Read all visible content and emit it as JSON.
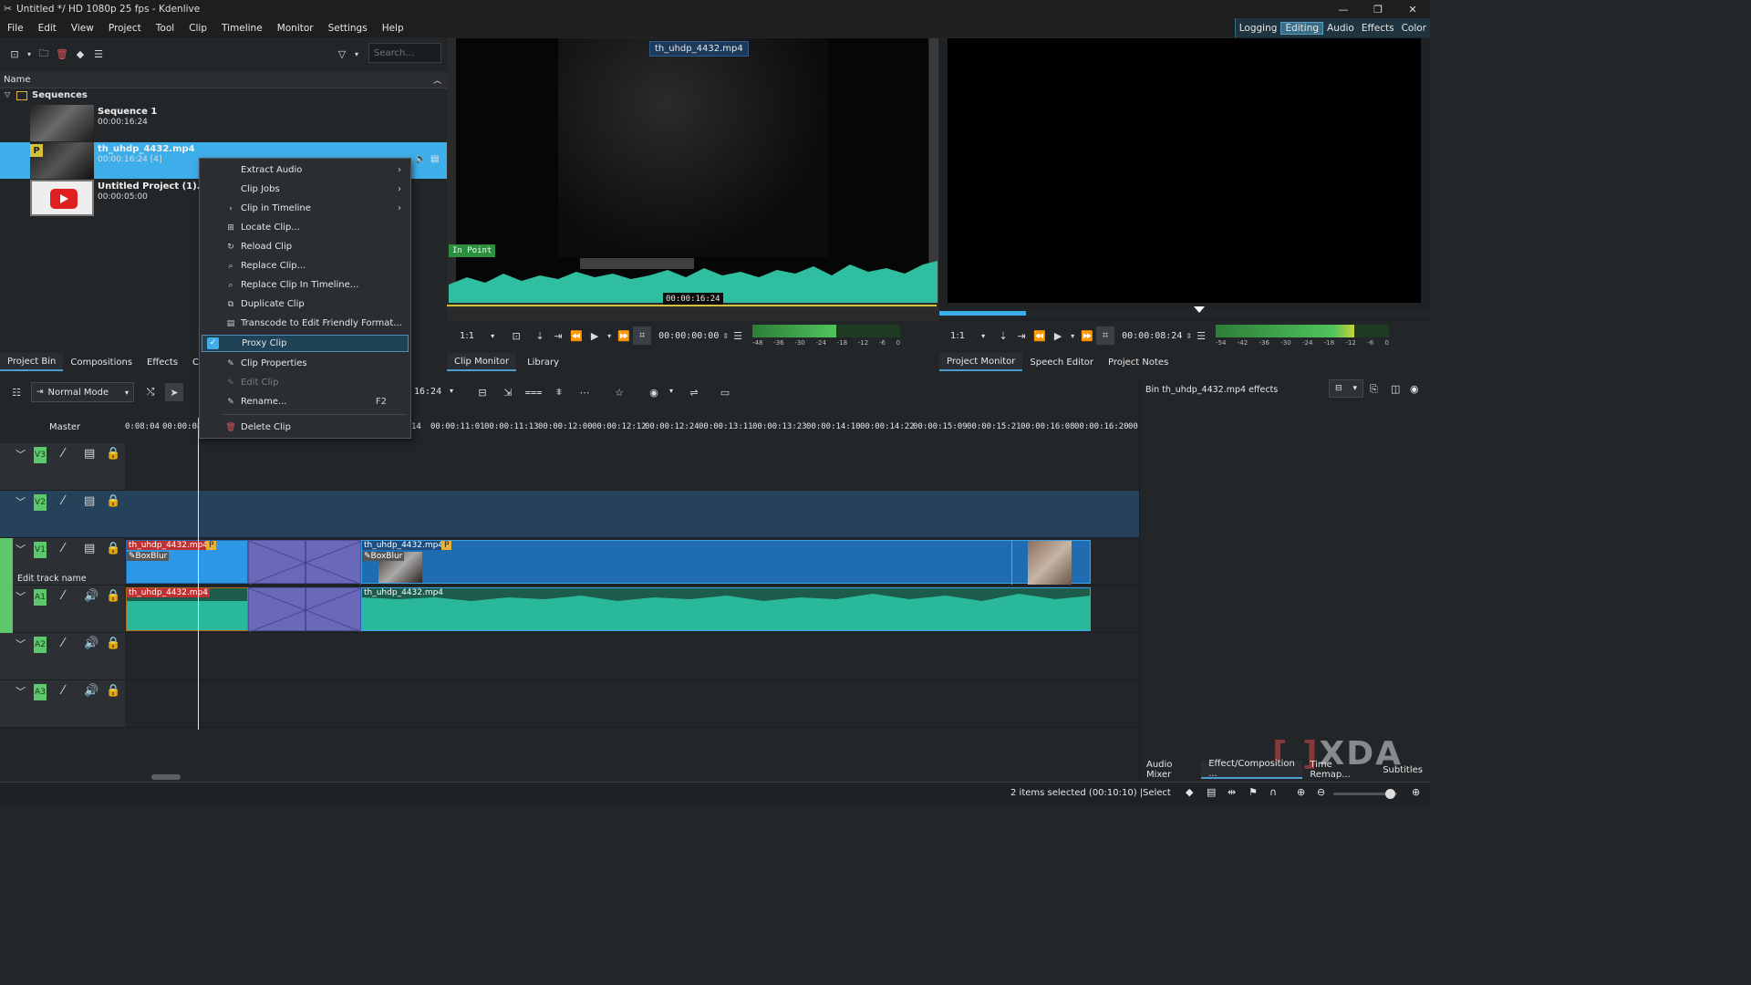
{
  "window": {
    "title": "Untitled */ HD 1080p 25 fps - Kdenlive",
    "controls": [
      "minimize-icon",
      "restore-icon",
      "close-icon"
    ]
  },
  "menu": [
    "File",
    "Edit",
    "View",
    "Project",
    "Tool",
    "Clip",
    "Timeline",
    "Monitor",
    "Settings",
    "Help"
  ],
  "layouts": {
    "items": [
      "Logging",
      "Editing",
      "Audio",
      "Effects",
      "Color"
    ],
    "active": "Editing"
  },
  "bin": {
    "search_placeholder": "Search...",
    "column": "Name",
    "folder": "Sequences",
    "clips": [
      {
        "name": "Sequence 1",
        "duration": "00:00:16:24"
      },
      {
        "name": "th_uhdp_4432.mp4",
        "duration": "00:00:16:24 [4]",
        "badge": "P"
      },
      {
        "name": "Untitled Project (1).png",
        "duration": "00:00:05:00"
      }
    ]
  },
  "context_menu": {
    "items": [
      {
        "label": "Extract Audio",
        "submenu": true
      },
      {
        "label": "Clip Jobs",
        "submenu": true
      },
      {
        "label": "Clip in Timeline",
        "submenu": true,
        "icon": "chevron-right-icon"
      },
      {
        "label": "Locate Clip...",
        "icon": "locate-icon"
      },
      {
        "label": "Reload Clip",
        "icon": "reload-icon"
      },
      {
        "label": "Replace Clip...",
        "icon": "search-icon"
      },
      {
        "label": "Replace Clip In Timeline...",
        "icon": "search-icon"
      },
      {
        "label": "Duplicate Clip",
        "icon": "duplicate-icon"
      },
      {
        "label": "Transcode to Edit Friendly Format...",
        "icon": "transcode-icon"
      },
      {
        "label": "Proxy Clip",
        "icon": "check-icon",
        "checked": true
      },
      {
        "label": "Clip Properties",
        "icon": "pencil-icon"
      },
      {
        "label": "Edit Clip",
        "icon": "pencil-icon",
        "disabled": true
      },
      {
        "label": "Rename...",
        "icon": "pencil-icon",
        "shortcut": "F2"
      },
      {
        "label": "Delete Clip",
        "icon": "trash-icon"
      }
    ]
  },
  "left_tabs": [
    "Project Bin",
    "Compositions",
    "Effects",
    "C"
  ],
  "clip_monitor": {
    "clip_label": "th_uhdp_4432.mp4",
    "in_point": "In Point",
    "overlay_timecode": "00:00:16:24",
    "zoom": "1:1",
    "timecode": "00:00:00:00",
    "meter_ticks": [
      "-48",
      "-36",
      "-30",
      "-24",
      "-18",
      "-12",
      "-6",
      "0"
    ],
    "tabs": [
      "Clip Monitor",
      "Library"
    ]
  },
  "project_monitor": {
    "zoom": "1:1",
    "timecode": "00:00:08:24",
    "meter_ticks": [
      "-54",
      "-42",
      "-36",
      "-30",
      "-24",
      "-18",
      "-12",
      "-6",
      "0"
    ],
    "tabs": [
      "Project Monitor",
      "Speech Editor",
      "Project Notes"
    ]
  },
  "timeline": {
    "mode": "Normal Mode",
    "position_partial": "16:24",
    "master_label": "Master",
    "ruler_ticks": [
      "0:08:04",
      "00:00:08:",
      "14",
      "00:00:11:01",
      "00:00:11:13",
      "00:00:12:00",
      "00:00:12:12",
      "00:00:12:24",
      "00:00:13:11",
      "00:00:13:23",
      "00:00:14:10",
      "00:00:14:22",
      "00:00:15:09",
      "00:00:15:21",
      "00:00:16:08",
      "00:00:16:20",
      "00"
    ],
    "tracks": [
      {
        "name": "V3",
        "type": "video"
      },
      {
        "name": "V2",
        "type": "video"
      },
      {
        "name": "V1",
        "type": "video",
        "edit_label": "Edit track name"
      },
      {
        "name": "A1",
        "type": "audio"
      },
      {
        "name": "A2",
        "type": "audio"
      },
      {
        "name": "A3",
        "type": "audio"
      }
    ],
    "clips": {
      "v1_a": {
        "name": "th_uhdp_4432.mp4",
        "badge": "P",
        "effect": "BoxBlur"
      },
      "v1_b": {
        "name": "th_uhdp_4432.mp4",
        "badge": "P",
        "effect": "BoxBlur"
      },
      "a1_a": {
        "name": "th_uhdp_4432.mp4"
      },
      "a1_b": {
        "name": "th_uhdp_4432.mp4"
      }
    }
  },
  "effect_panel": {
    "title": "Bin th_uhdp_4432.mp4 effects"
  },
  "right_tabs": [
    "Audio Mixer",
    "Effect/Composition ...",
    "Time Remap...",
    "Subtitles"
  ],
  "status": {
    "selection": "2 items selected (00:10:10) |",
    "tool": "Select"
  },
  "watermark": "XDA",
  "colors": {
    "accent": "#3daee9",
    "clip_video": "#2277c0",
    "clip_audio": "#29b99a",
    "track_label": "#5cc76b"
  }
}
